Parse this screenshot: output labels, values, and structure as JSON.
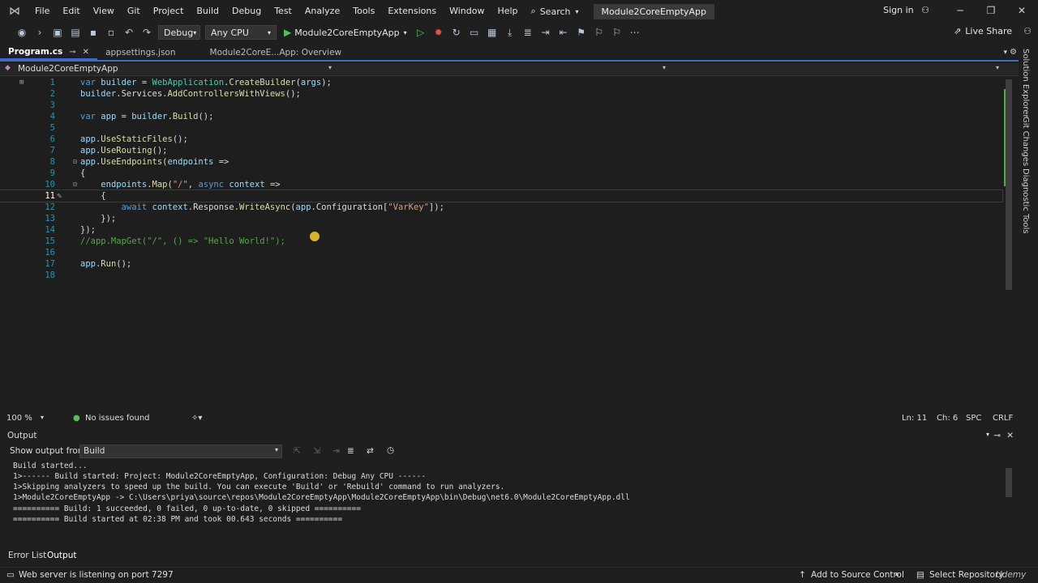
{
  "menu": {
    "items": [
      "File",
      "Edit",
      "View",
      "Git",
      "Project",
      "Build",
      "Debug",
      "Test",
      "Analyze",
      "Tools",
      "Extensions",
      "Window",
      "Help"
    ],
    "search_label": "Search",
    "solution_name": "Module2CoreEmptyApp",
    "signin_label": "Sign in"
  },
  "toolbar": {
    "config": "Debug",
    "platform": "Any CPU",
    "run_target": "Module2CoreEmptyApp",
    "liveshare_label": "Live Share"
  },
  "tabs": [
    {
      "label": "Program.cs",
      "active": true
    },
    {
      "label": "appsettings.json",
      "active": false
    },
    {
      "label": "Module2CoreE...App: Overview",
      "active": false
    }
  ],
  "navbar": {
    "project": "Module2CoreEmptyApp"
  },
  "side_tabs": [
    "Solution Explorer",
    "Git Changes",
    "Diagnostic Tools"
  ],
  "editor": {
    "current_line": 11,
    "lines": [
      {
        "n": "1",
        "text": "var builder = WebApplication.CreateBuilder(args);"
      },
      {
        "n": "2",
        "text": "builder.Services.AddControllersWithViews();"
      },
      {
        "n": "3",
        "text": ""
      },
      {
        "n": "4",
        "text": "var app = builder.Build();"
      },
      {
        "n": "5",
        "text": ""
      },
      {
        "n": "6",
        "text": "app.UseStaticFiles();"
      },
      {
        "n": "7",
        "text": "app.UseRouting();"
      },
      {
        "n": "8",
        "text": "app.UseEndpoints(endpoints =>"
      },
      {
        "n": "9",
        "text": "{"
      },
      {
        "n": "10",
        "text": "    endpoints.Map(\"/\", async context =>"
      },
      {
        "n": "11",
        "text": "    {"
      },
      {
        "n": "12",
        "text": "        await context.Response.WriteAsync(app.Configuration[\"VarKey\"]);"
      },
      {
        "n": "13",
        "text": "    });"
      },
      {
        "n": "14",
        "text": "});"
      },
      {
        "n": "15",
        "text": "//app.MapGet(\"/\", () => \"Hello World!\");"
      },
      {
        "n": "16",
        "text": ""
      },
      {
        "n": "17",
        "text": "app.Run();"
      },
      {
        "n": "18",
        "text": ""
      }
    ]
  },
  "editor_status": {
    "zoom": "100 %",
    "issues": "No issues found",
    "line": "Ln: 11",
    "col": "Ch: 6",
    "whitespace": "SPC",
    "line_endings": "CRLF"
  },
  "output": {
    "title": "Output",
    "source_label": "Show output from:",
    "source_value": "Build",
    "lines": [
      "Build started...",
      "1>------ Build started: Project: Module2CoreEmptyApp, Configuration: Debug Any CPU ------",
      "1>Skipping analyzers to speed up the build. You can execute 'Build' or 'Rebuild' command to run analyzers.",
      "1>Module2CoreEmptyApp -> C:\\Users\\priya\\source\\repos\\Module2CoreEmptyApp\\Module2CoreEmptyApp\\bin\\Debug\\net6.0\\Module2CoreEmptyApp.dll",
      "========== Build: 1 succeeded, 0 failed, 0 up-to-date, 0 skipped ==========",
      "========== Build started at 02:38 PM and took 00.643 seconds =========="
    ]
  },
  "bottom_tabs": [
    "Error List",
    "Output"
  ],
  "statusbar": {
    "message": "Web server is listening on port 7297",
    "source_control": "Add to Source Control",
    "repository": "Select Repository"
  },
  "watermark": "Udemy"
}
